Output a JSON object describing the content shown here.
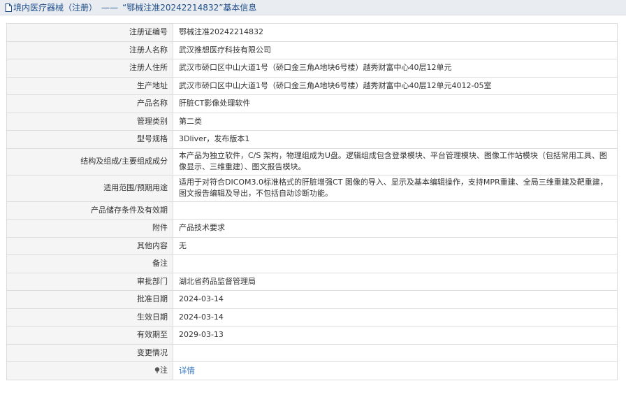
{
  "header": {
    "section": "境内医疗器械（注册）",
    "separator": "——",
    "record_title": "“鄂械注准20242214832”基本信息"
  },
  "rows": [
    {
      "label": "注册证编号",
      "value": "鄂械注准20242214832"
    },
    {
      "label": "注册人名称",
      "value": "武汉推想医疗科技有限公司"
    },
    {
      "label": "注册人住所",
      "value": "武汉市硚口区中山大道1号（硚口金三角A地块6号楼）越秀财富中心40层12单元"
    },
    {
      "label": "生产地址",
      "value": "武汉市硚口区中山大道1号（硚口金三角A地块6号楼）越秀财富中心40层12单元4012-05室"
    },
    {
      "label": "产品名称",
      "value": "肝脏CT影像处理软件"
    },
    {
      "label": "管理类别",
      "value": "第二类"
    },
    {
      "label": "型号规格",
      "value": "3Dliver，发布版本1"
    },
    {
      "label": "结构及组成/主要组成成分",
      "value": "本产品为独立软件，C/S 架构，物理组成为U盘。逻辑组成包含登录模块、平台管理模块、图像工作站模块（包括常用工具、图像显示、三维重建）、图文报告模块。"
    },
    {
      "label": "适用范围/预期用途",
      "value": "适用于对符合DICOM3.0标准格式的肝脏增强CT 图像的导入、显示及基本编辑操作，支持MPR重建、全局三维重建及靶重建，图文报告编辑及导出，不包括自动诊断功能。"
    },
    {
      "label": "产品储存条件及有效期",
      "value": ""
    },
    {
      "label": "附件",
      "value": "产品技术要求"
    },
    {
      "label": "其他内容",
      "value": "无"
    },
    {
      "label": "备注",
      "value": ""
    },
    {
      "label": "审批部门",
      "value": "湖北省药品监督管理局"
    },
    {
      "label": "批准日期",
      "value": "2024-03-14"
    },
    {
      "label": "生效日期",
      "value": "2024-03-14"
    },
    {
      "label": "有效期至",
      "value": "2029-03-13"
    },
    {
      "label": "变更情况",
      "value": ""
    }
  ],
  "note": {
    "icon": "pin-icon",
    "label": "注",
    "link": "详情"
  }
}
